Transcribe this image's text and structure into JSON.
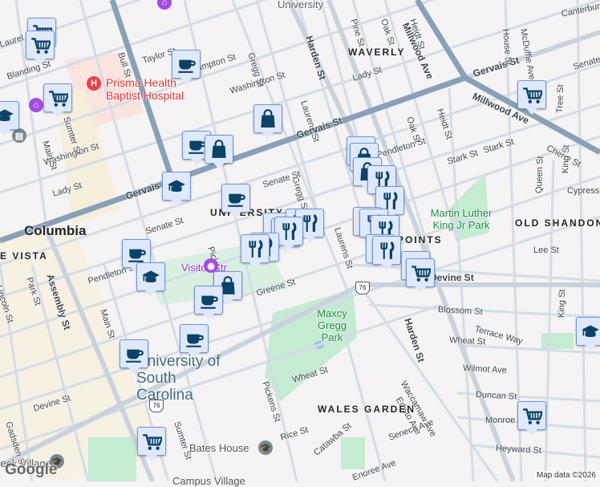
{
  "map": {
    "attribution": "Map data ©2026",
    "logo": "Google",
    "labels": {
      "bull_st": "Bull St",
      "taylor_st": "Taylor St",
      "hampton_st": "Hampton St",
      "washington_st": "Washington St",
      "washington_st_w": "Washington St",
      "gregg_st": "Gregg St",
      "gregg_st_s": "Gregg St",
      "laurens_st": "Laurens St",
      "laurens_st_s": "Laurens St",
      "harden_st": "Harden St",
      "harden_st_s": "Harden St",
      "gervais_st": "Gervais St",
      "gervais_st_e": "Gervais St",
      "gervais_st_w": "Gervais St",
      "senate_st": "Senate St",
      "senate_st_w": "Senate St",
      "senate_st_e": "Senate St",
      "lady_st": "Lady St",
      "lady_st_e": "Lady St",
      "blanding_st": "Blanding St",
      "laurel_st": "Laurel St",
      "sumter_st": "Sumter St",
      "sumter_st_s": "Sumter St",
      "main_st": "Main St",
      "main_st_s": "Main St",
      "assembly_st": "Assembly St",
      "park_st": "Park St",
      "lincoln_st": "Lincoln St",
      "pendleton_st": "Pendleton St",
      "pendleton_st_e": "Pendleton St",
      "pickens_st": "Pickens St",
      "pickens_st_s": "Pickens St",
      "greene_st": "Greene St",
      "devine_st": "Devine St",
      "devine_st_e": "Devine St",
      "gadsden_st": "Gadsden St",
      "pine_st": "Pine St",
      "oak_st": "Oak St",
      "oak_st_s": "Oak St",
      "heidt_st": "Heidt St",
      "heidt_st_s": "Heidt St",
      "millwood_ave": "Millwood Ave",
      "millwood_ave_n": "Millwood Ave",
      "house_st": "House St",
      "mcduffie_ave": "McDuffie Ave",
      "canterbury": "Canterbury",
      "stark_st": "Stark St",
      "stark_st_e": "Stark St",
      "cherry_st": "Cherry St",
      "tree_st": "Tree St",
      "queen_st": "Queen St",
      "king_st": "King St",
      "king_st_s": "King St",
      "cypress": "Cypress",
      "lee_st": "Lee St",
      "blossom_st": "Blossom St",
      "terrace_way": "Terrace Way",
      "wheat_st": "Wheat St",
      "wheat_st_w": "Wheat St",
      "wilmot_ave": "Wilmot Ave",
      "duncan_st": "Duncan St",
      "monroe": "Monroe",
      "heyward_st": "Heyward St",
      "waccamaw_ave": "Waccamaw Ave",
      "edisto_ave": "Edisto Ave",
      "seneca_ave": "Seneca Ave",
      "catawba_st": "Catawba St",
      "enoree_ave": "Enoree Ave",
      "rice_st": "Rice St",
      "university": "University"
    },
    "neighborhoods": {
      "waverly": "WAVERLY",
      "university_hill": "UNIVERSITY HILL",
      "old_shandon": "OLD SHANDON",
      "five_points": "FIVE POINTS",
      "wales_garden": "WALES GARDEN",
      "vista": "E VISTA"
    },
    "places": {
      "columbia": "Columbia",
      "hospital": "Prisma Health Baptist Hospital",
      "mlk_park": "Martin Luther King Jr Park",
      "maxcy_park": "Maxcy Gregg Park",
      "usc": "University of South Carolina",
      "bates_house": "Bates House",
      "visitor_ctr": "Visitor Ctr",
      "greek_village": "Greek Village",
      "campus_village": "Campus Village"
    },
    "route_shield": "76",
    "markers": [
      "cart",
      "cart",
      "cart",
      "education",
      "coffee",
      "bag",
      "coffee",
      "bag",
      "education",
      "coffee",
      "coffee",
      "education",
      "bag",
      "coffee",
      "coffee",
      "coffee",
      "cart",
      "restaurant",
      "restaurant",
      "restaurant",
      "restaurant",
      "restaurant",
      "restaurant",
      "restaurant",
      "cart",
      "bag",
      "bag",
      "restaurant",
      "restaurant",
      "bag",
      "restaurant",
      "restaurant",
      "restaurant",
      "restaurant",
      "cart",
      "cart",
      "cart",
      "education",
      "cart"
    ]
  }
}
